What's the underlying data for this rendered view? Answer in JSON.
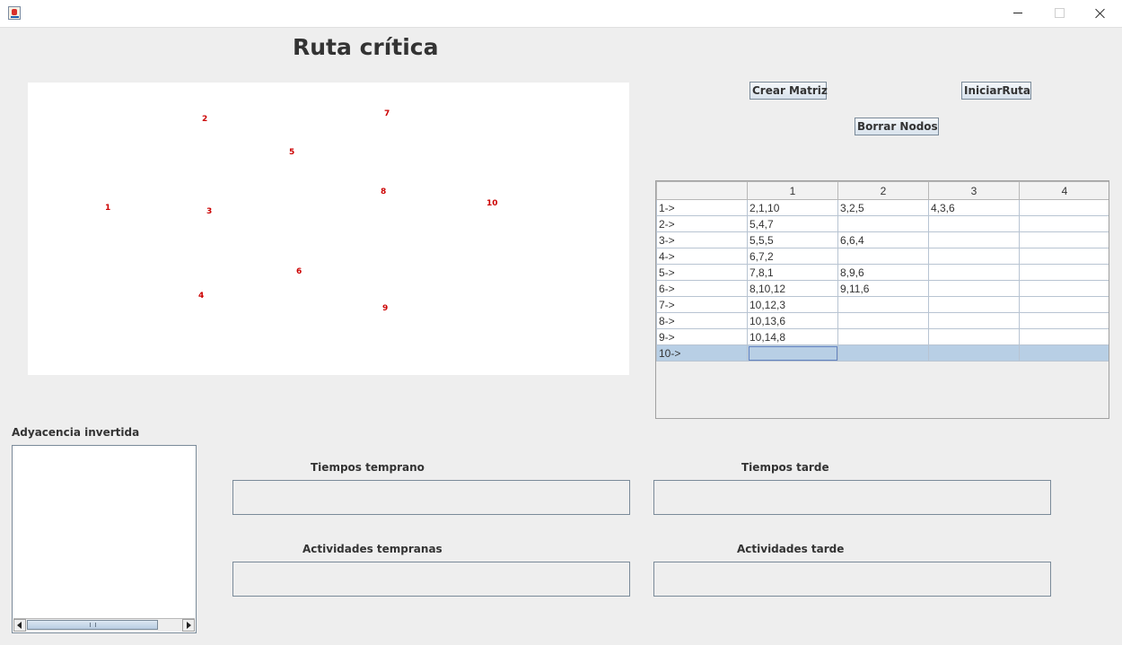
{
  "window": {
    "icon": "java-cup-icon",
    "controls": [
      "minimize-icon",
      "maximize-icon",
      "close-icon"
    ]
  },
  "title": "Ruta crítica",
  "graph": {
    "nodes": [
      "1",
      "2",
      "3",
      "4",
      "5",
      "6",
      "7",
      "8",
      "9",
      "10"
    ],
    "node_color": "#cc0000"
  },
  "buttons": {
    "crear_matriz": "Crear Matriz",
    "iniciar_ruta": "IniciarRuta",
    "borrar_nodos": "Borrar Nodos"
  },
  "matrix": {
    "headers": [
      "",
      "1",
      "2",
      "3",
      "4"
    ],
    "rows": [
      [
        "1->",
        "2,1,10",
        "3,2,5",
        "4,3,6",
        ""
      ],
      [
        "2->",
        "5,4,7",
        "",
        "",
        ""
      ],
      [
        "3->",
        "5,5,5",
        "6,6,4",
        "",
        ""
      ],
      [
        "4->",
        "6,7,2",
        "",
        "",
        ""
      ],
      [
        "5->",
        "7,8,1",
        "8,9,6",
        "",
        ""
      ],
      [
        "6->",
        "8,10,12",
        "9,11,6",
        "",
        ""
      ],
      [
        "7->",
        "10,12,3",
        "",
        "",
        ""
      ],
      [
        "8->",
        "10,13,6",
        "",
        "",
        ""
      ],
      [
        "9->",
        "10,14,8",
        "",
        "",
        ""
      ],
      [
        "10->",
        "",
        "",
        "",
        ""
      ]
    ],
    "selected_row": 10,
    "selection_color": "#b8cfe5"
  },
  "adyacencia": {
    "label": "Adyacencia invertida",
    "content": ""
  },
  "fields": {
    "tiempos_temprano": {
      "label": "Tiempos temprano",
      "value": ""
    },
    "tiempos_tarde": {
      "label": "Tiempos tarde",
      "value": ""
    },
    "actividades_tempranas": {
      "label": "Actividades tempranas",
      "value": ""
    },
    "actividades_tarde": {
      "label": "Actividades tarde",
      "value": ""
    }
  }
}
